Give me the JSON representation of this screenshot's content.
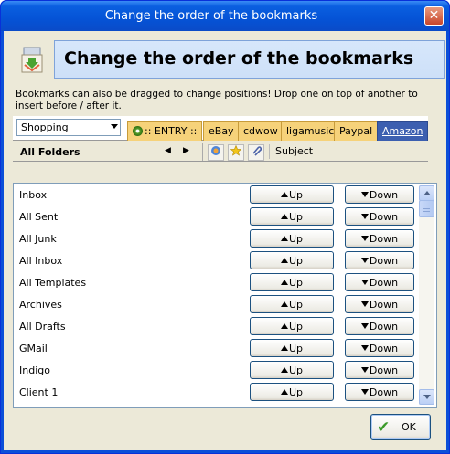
{
  "window": {
    "title": "Change the order of the bookmarks",
    "close_glyph": "✕"
  },
  "header": {
    "title": "Change the order of the bookmarks",
    "icon": "bookmark-order-icon"
  },
  "info_text": "Bookmarks can also be dragged to change positions! Drop one on top of another to insert before / after it.",
  "toolbar": {
    "folder_select": "Shopping",
    "tabs": [
      ":: ENTRY ::",
      "eBay",
      "cdwow",
      "ligamusic",
      "Paypal",
      "Amazon"
    ],
    "active_tab": "Amazon"
  },
  "nav": {
    "all_folders": "All Folders",
    "prev_glyph": "◀",
    "next_glyph": "▶",
    "subject": "Subject"
  },
  "rows": [
    {
      "label": "Inbox"
    },
    {
      "label": "All Sent"
    },
    {
      "label": "All Junk"
    },
    {
      "label": "All Inbox"
    },
    {
      "label": "All Templates"
    },
    {
      "label": "Archives"
    },
    {
      "label": "All Drafts"
    },
    {
      "label": "GMail"
    },
    {
      "label": "Indigo"
    },
    {
      "label": "Client 1"
    }
  ],
  "buttons": {
    "up": "Up",
    "down": "Down",
    "ok": "OK"
  },
  "colors": {
    "title_bar": "#0553d6",
    "client_bg": "#ece9d8",
    "tab_bg": "#f6d27a",
    "active_tab": "#3c5fb0"
  }
}
